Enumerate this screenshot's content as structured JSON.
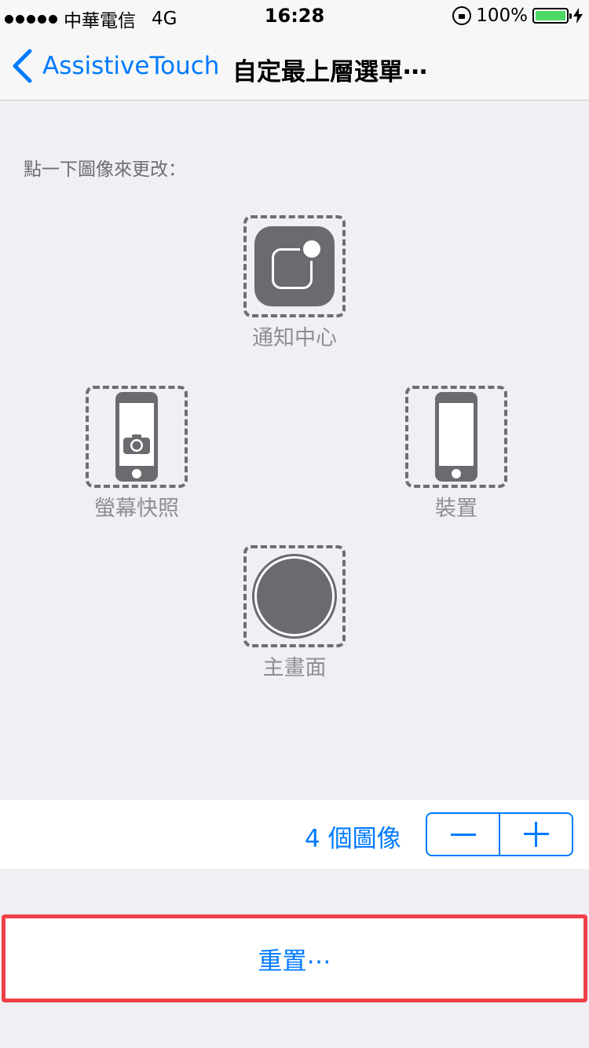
{
  "status_bar": {
    "carrier": "中華電信",
    "network": "4G",
    "time": "16:28",
    "battery": "100%",
    "battery_level": 1.0
  },
  "nav": {
    "back_label": "AssistiveTouch",
    "title": "自定最上層選單⋯"
  },
  "instruction": "點一下圖像來更改：",
  "icons": {
    "top": {
      "label": "通知中心",
      "icon": "notification-center-icon"
    },
    "left": {
      "label": "螢幕快照",
      "icon": "screenshot-icon"
    },
    "right": {
      "label": "裝置",
      "icon": "device-icon"
    },
    "bottom": {
      "label": "主畫面",
      "icon": "home-icon"
    }
  },
  "count_row": {
    "count_label": "4 個圖像",
    "minus": "minus-icon",
    "plus": "plus-icon"
  },
  "reset": {
    "label": "重置⋯"
  },
  "colors": {
    "accent": "#007aff",
    "background": "#efeff4",
    "icon_gray": "#6b6a6f",
    "highlight": "#f04148",
    "battery": "#4cd964"
  }
}
